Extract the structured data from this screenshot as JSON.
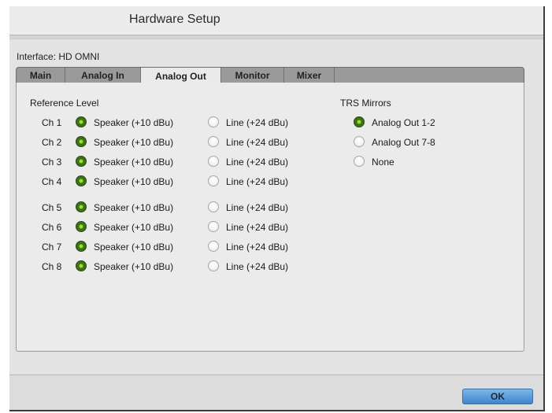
{
  "window": {
    "title": "Hardware Setup"
  },
  "interface": {
    "label": "Interface: HD OMNI"
  },
  "tabs": [
    "Main",
    "Analog In",
    "Analog Out",
    "Monitor",
    "Mixer"
  ],
  "active_tab": "Analog Out",
  "reference_level": {
    "heading": "Reference Level",
    "speaker_label": "Speaker (+10 dBu)",
    "line_label": "Line (+24 dBu)",
    "channels": [
      {
        "name": "Ch 1",
        "selected": "speaker"
      },
      {
        "name": "Ch 2",
        "selected": "speaker"
      },
      {
        "name": "Ch 3",
        "selected": "speaker"
      },
      {
        "name": "Ch 4",
        "selected": "speaker"
      },
      {
        "name": "Ch 5",
        "selected": "speaker"
      },
      {
        "name": "Ch 6",
        "selected": "speaker"
      },
      {
        "name": "Ch 7",
        "selected": "speaker"
      },
      {
        "name": "Ch 8",
        "selected": "speaker"
      }
    ]
  },
  "trs_mirrors": {
    "heading": "TRS Mirrors",
    "options": [
      {
        "label": "Analog Out 1-2",
        "selected": true
      },
      {
        "label": "Analog Out 7-8",
        "selected": false
      },
      {
        "label": "None",
        "selected": false
      }
    ]
  },
  "footer": {
    "ok_label": "OK"
  }
}
